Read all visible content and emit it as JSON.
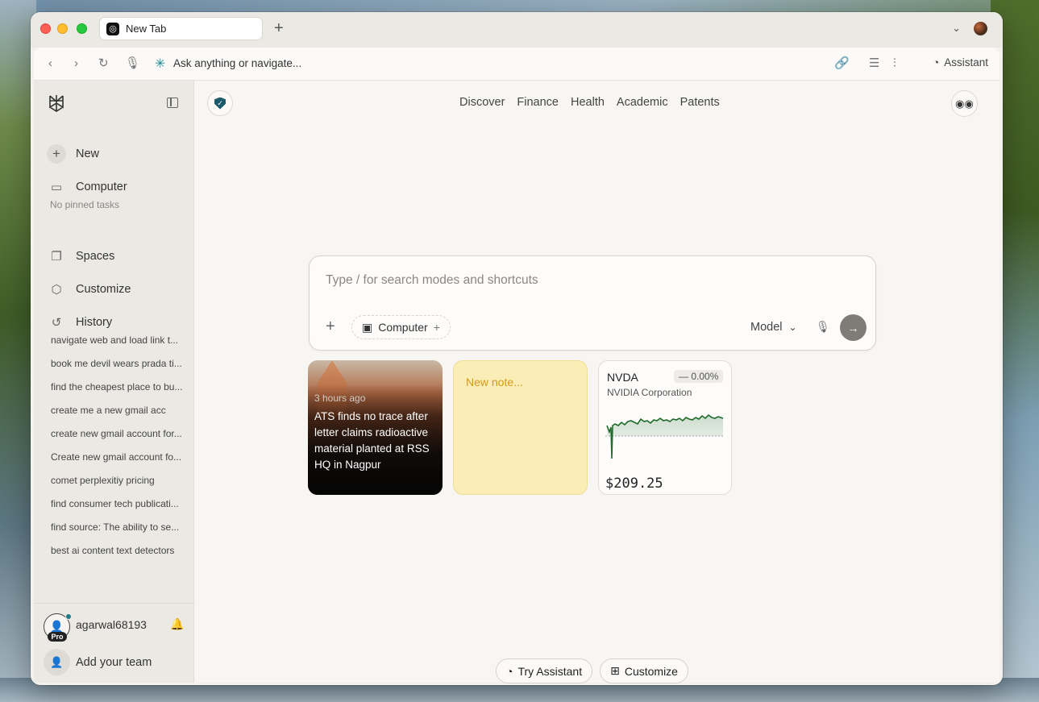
{
  "browser": {
    "tab_title": "New Tab",
    "new_tab_symbol": "+",
    "address_placeholder": "Ask anything or navigate...",
    "assistant_label": "Assistant"
  },
  "sidebar": {
    "new_label": "New",
    "computer_label": "Computer",
    "no_pinned": "No pinned tasks",
    "spaces_label": "Spaces",
    "customize_label": "Customize",
    "history_label": "History",
    "history_items": [
      "navigate web and load link t...",
      "book me devil wears prada ti...",
      "find the cheapest place to bu...",
      "create me a new gmail acc",
      "create new gmail account for...",
      "Create new gmail account fo...",
      "comet perplexitiy pricing",
      "find consumer tech publicati...",
      "find source: The ability to se...",
      "best ai content text detectors"
    ],
    "username": "agarwal68193",
    "pro_badge": "Pro",
    "team_label": "Add your team"
  },
  "main": {
    "nav": [
      "Discover",
      "Finance",
      "Health",
      "Academic",
      "Patents"
    ],
    "search_placeholder": "Type / for search modes and shortcuts",
    "computer_pill": "Computer",
    "model_label": "Model",
    "news": {
      "time": "3 hours ago",
      "title": "ATS finds no trace after letter claims radioactive material planted at RSS HQ in Nagpur"
    },
    "note": {
      "placeholder": "New note..."
    },
    "stock": {
      "ticker": "NVDA",
      "change": "0.00%",
      "company": "NVIDIA Corporation",
      "price": "$209.25",
      "line_color": "#1f6b2a"
    },
    "try_assistant": "Try Assistant",
    "customize": "Customize"
  },
  "colors": {
    "accent_teal": "#1f8a99",
    "note_bg": "#fbedb6",
    "send_btn": "#7f7c78"
  }
}
